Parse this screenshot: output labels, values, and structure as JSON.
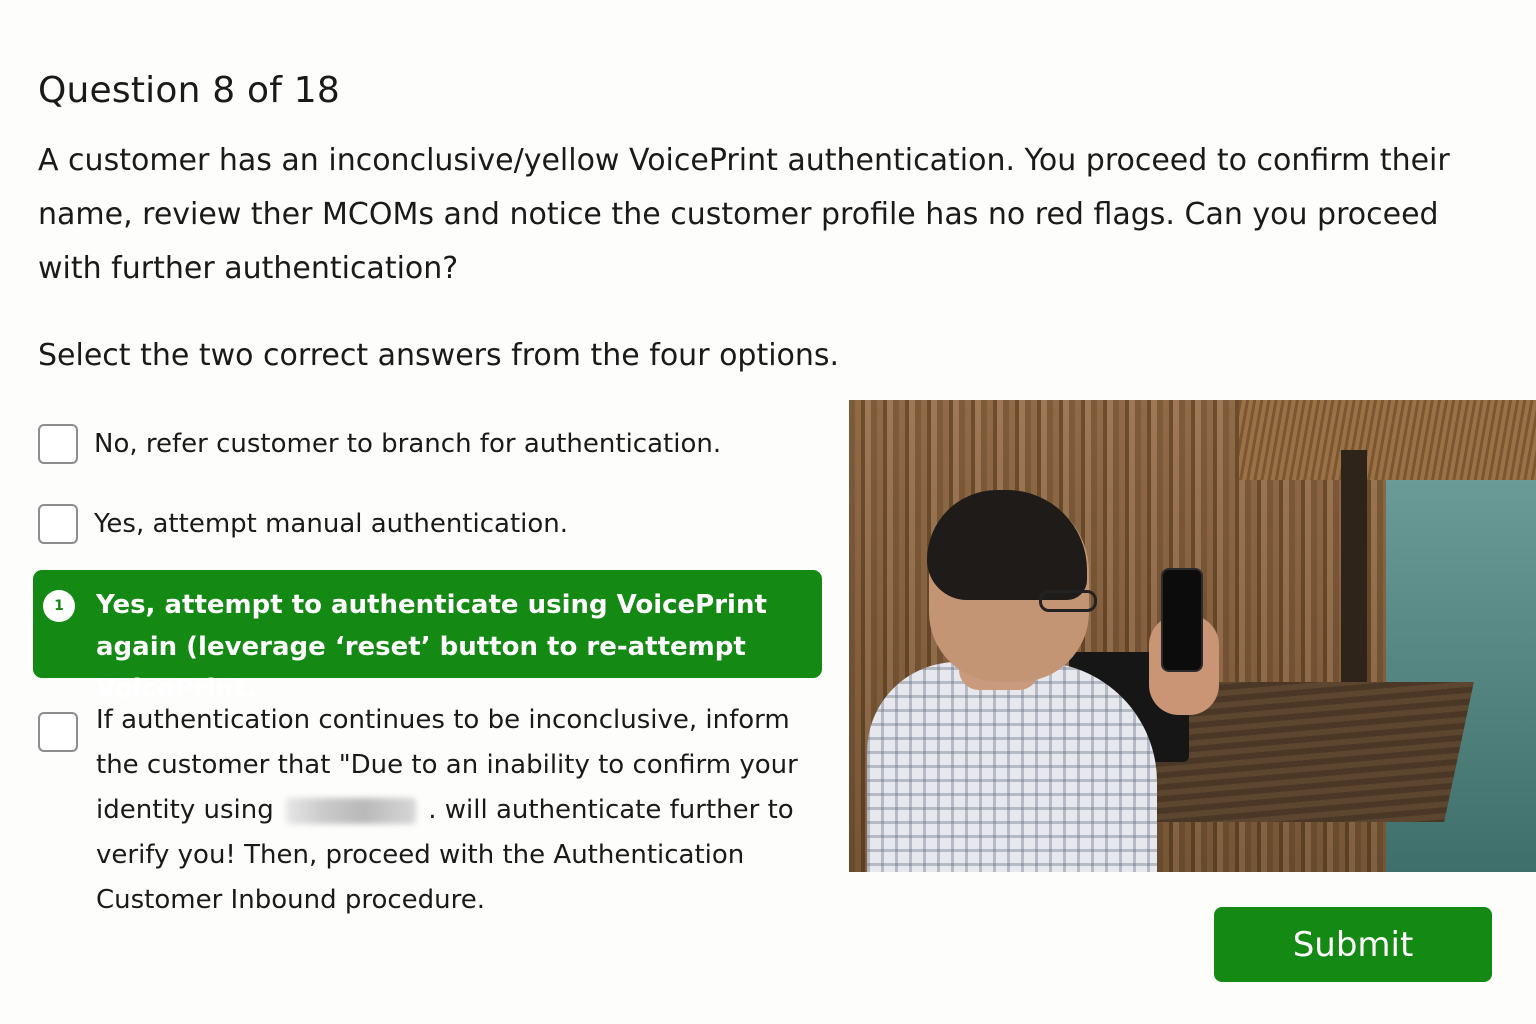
{
  "quiz": {
    "counter": "Question 8 of 18",
    "question": "A customer has an inconclusive/yellow VoicePrint authentication. You proceed to confirm their name, review ther MCOMs and notice the customer profile has no red flags. Can you proceed with further authentication?",
    "instruction": "Select the two correct answers from the four options."
  },
  "options": [
    {
      "label": "No, refer customer to branch for authentication.",
      "selected": false
    },
    {
      "label": "Yes, attempt manual authentication.",
      "selected": false
    },
    {
      "label": "Yes, attempt to authenticate using VoicePrint again (leverage ‘reset’ button to re-attempt VoicePrint.",
      "selected": true,
      "badge": "1"
    },
    {
      "label_before": "If authentication continues to be inconclusive, inform the customer that \"Due to an inability to confirm your identity using",
      "label_after": ". will authenticate further to verify you! Then, proceed with the Authentication Customer Inbound procedure.",
      "selected": false
    }
  ],
  "photo": {
    "subject": "man-holding-phone-photo"
  },
  "actions": {
    "submit_label": "Submit"
  },
  "colors": {
    "accent": "#148a14",
    "background": "#fdfdfb"
  }
}
